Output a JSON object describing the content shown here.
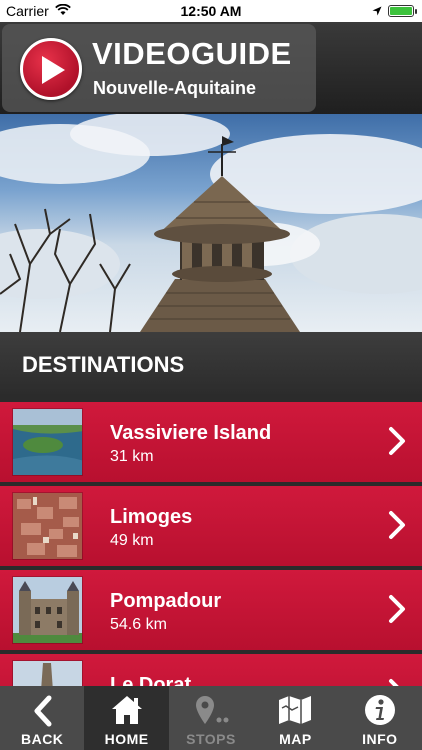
{
  "status_bar": {
    "carrier": "Carrier",
    "time": "12:50 AM",
    "battery_level": 1.0
  },
  "header": {
    "title": "VIDEOGUIDE",
    "subtitle": "Nouvelle-Aquitaine",
    "logo_icon": "play-icon"
  },
  "hero": {
    "image": "bell-tower-photo"
  },
  "destinations": {
    "title": "DESTINATIONS",
    "items": [
      {
        "name": "Vassiviere Island",
        "distance": "31 km",
        "thumb": "lake-aerial-photo"
      },
      {
        "name": "Limoges",
        "distance": "49 km",
        "thumb": "city-rooftops-photo"
      },
      {
        "name": "Pompadour",
        "distance": "54.6 km",
        "thumb": "castle-photo"
      },
      {
        "name": "Le Dorat",
        "distance": "",
        "thumb": "church-tower-photo"
      }
    ]
  },
  "tabs": [
    {
      "label": "BACK",
      "icon": "chevron-left-icon",
      "state": "normal"
    },
    {
      "label": "HOME",
      "icon": "home-icon",
      "state": "active"
    },
    {
      "label": "STOPS",
      "icon": "map-pin-icon",
      "state": "disabled"
    },
    {
      "label": "MAP",
      "icon": "map-icon",
      "state": "normal"
    },
    {
      "label": "INFO",
      "icon": "info-icon",
      "state": "normal"
    }
  ],
  "colors": {
    "accent": "#c8143a",
    "tabbar": "#4a4a4a",
    "tab_active": "#2e2e2e",
    "battery": "#3cc23c"
  }
}
